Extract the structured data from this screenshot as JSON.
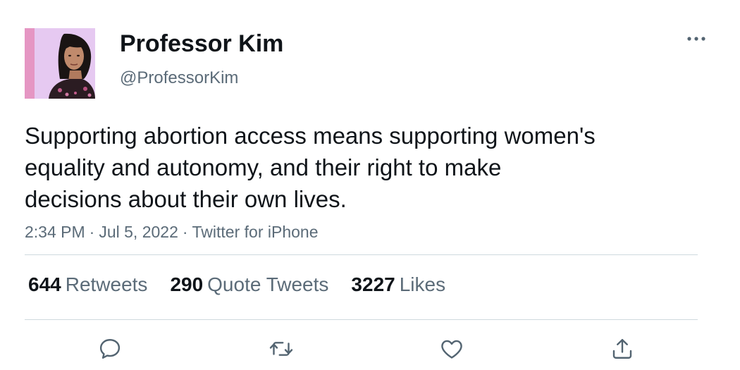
{
  "author": {
    "name": "Professor Kim",
    "handle": "@ProfessorKim"
  },
  "tweet": {
    "text": "Supporting abortion access means supporting women's\nequality and autonomy, and their right to make\ndecisions about their own lives.",
    "time": "2:34 PM",
    "date": "Jul 5, 2022",
    "source": "Twitter for iPhone",
    "separator": "·"
  },
  "stats": {
    "retweets": {
      "count": "644",
      "label": "Retweets"
    },
    "quotes": {
      "count": "290",
      "label": "Quote Tweets"
    },
    "likes": {
      "count": "3227",
      "label": "Likes"
    }
  },
  "icons": {
    "more": "more-horizontal-icon",
    "reply": "reply-icon",
    "retweet": "retweet-icon",
    "like": "heart-icon",
    "share": "share-icon"
  },
  "colors": {
    "text_primary": "#0f1419",
    "text_secondary": "#5b6b78",
    "divider": "#cfd9de",
    "icon": "#536471"
  }
}
